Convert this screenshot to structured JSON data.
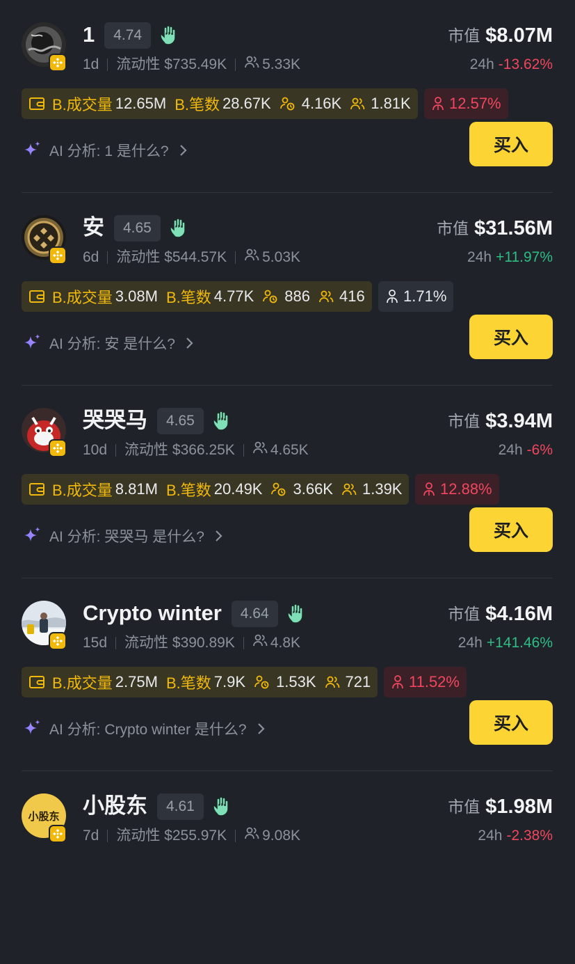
{
  "labels": {
    "market_cap": "市值",
    "change_period": "24h",
    "liquidity": "流动性",
    "b_volume": "B.成交量",
    "b_trades": "B.笔数",
    "ai_prefix": "AI 分析:",
    "buy": "买入"
  },
  "colors": {
    "accent": "#fcd535",
    "up": "#2ebd85",
    "down": "#f0475e",
    "chain_badge": "#f0b90b"
  },
  "tokens": [
    {
      "name": "1",
      "score": "4.74",
      "age": "1d",
      "liquidity": "$735.49K",
      "holders": "5.33K",
      "market_cap": "$8.07M",
      "change": "-13.62%",
      "direction": "down",
      "b_volume": "12.65M",
      "b_trades": "28.67K",
      "stat_a": "4.16K",
      "stat_b": "1.81K",
      "top_pct": "12.57%",
      "top_pct_style": "red",
      "ai_question": "1 是什么?",
      "avatar_icon": "dark-rock-avatar"
    },
    {
      "name": "安",
      "score": "4.65",
      "age": "6d",
      "liquidity": "$544.57K",
      "holders": "5.03K",
      "market_cap": "$31.56M",
      "change": "+11.97%",
      "direction": "up",
      "b_volume": "3.08M",
      "b_trades": "4.77K",
      "stat_a": "886",
      "stat_b": "416",
      "top_pct": "1.71%",
      "top_pct_style": "gray",
      "ai_question": "安 是什么?",
      "avatar_icon": "gold-coin-avatar"
    },
    {
      "name": "哭哭马",
      "score": "4.65",
      "age": "10d",
      "liquidity": "$366.25K",
      "holders": "4.65K",
      "market_cap": "$3.94M",
      "change": "-6%",
      "direction": "down",
      "b_volume": "8.81M",
      "b_trades": "20.49K",
      "stat_a": "3.66K",
      "stat_b": "1.39K",
      "top_pct": "12.88%",
      "top_pct_style": "red",
      "ai_question": "哭哭马 是什么?",
      "avatar_icon": "red-horse-avatar"
    },
    {
      "name": "Crypto winter",
      "score": "4.64",
      "age": "15d",
      "liquidity": "$390.89K",
      "holders": "4.8K",
      "market_cap": "$4.16M",
      "change": "+141.46%",
      "direction": "up",
      "b_volume": "2.75M",
      "b_trades": "7.9K",
      "stat_a": "1.53K",
      "stat_b": "721",
      "top_pct": "11.52%",
      "top_pct_style": "red",
      "ai_question": "Crypto winter 是什么?",
      "avatar_icon": "snow-photo-avatar"
    },
    {
      "name": "小股东",
      "score": "4.61",
      "age": "7d",
      "liquidity": "$255.97K",
      "holders": "9.08K",
      "market_cap": "$1.98M",
      "change": "-2.38%",
      "direction": "down",
      "avatar_text": "小股东",
      "avatar_icon": "yellow-text-avatar"
    }
  ]
}
